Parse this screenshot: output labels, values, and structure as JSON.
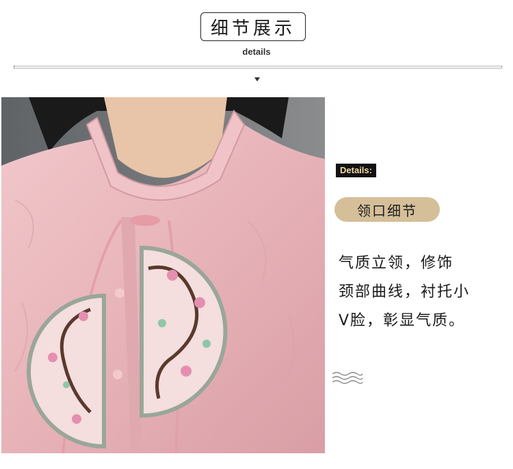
{
  "header": {
    "title": "细节展示",
    "subtitle": "details"
  },
  "side": {
    "tag": "Details:",
    "pill": "领口细节",
    "description_lines": [
      "气质立领，修饰",
      "颈部曲线，衬托小",
      "V脸，彰显气质。"
    ]
  },
  "icons": {
    "down": "caret-down-icon",
    "waves": "waves-icon"
  },
  "colors": {
    "tag_bg": "#121212",
    "tag_text": "#f3d9a6",
    "pill_bg": "#d5bf99",
    "blouse": "#e9b8bd"
  }
}
